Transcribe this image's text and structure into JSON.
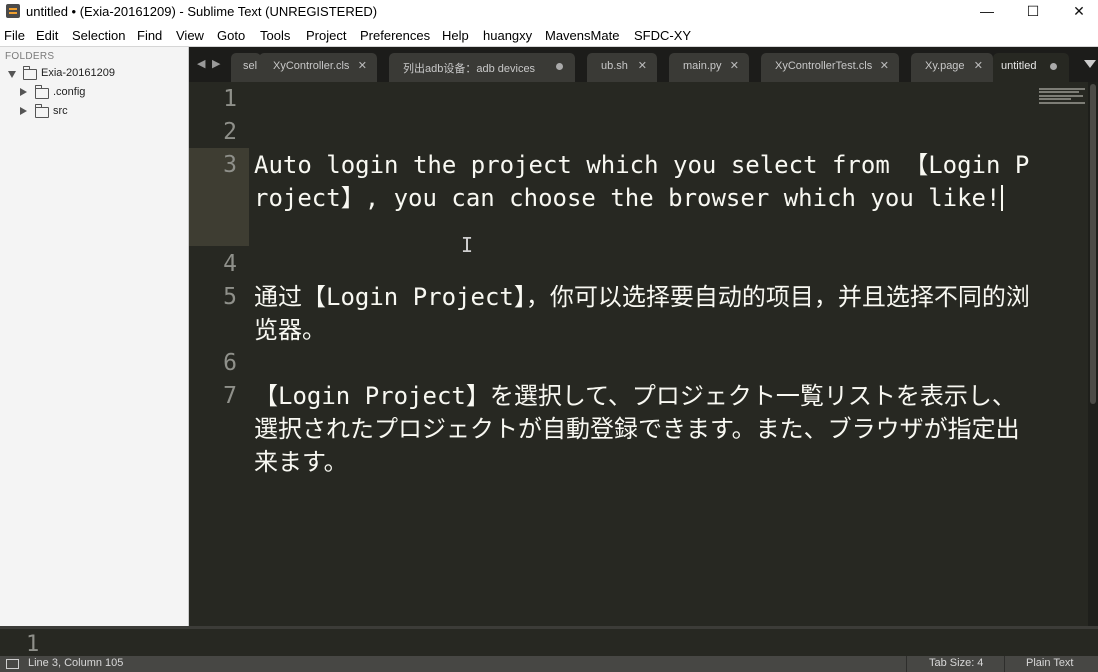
{
  "window": {
    "title": "untitled • (Exia-20161209) - Sublime Text (UNREGISTERED)",
    "minimize": "—",
    "maximize": "☐",
    "close": "✕"
  },
  "menu": [
    "File",
    "Edit",
    "Selection",
    "Find",
    "View",
    "Goto",
    "Tools",
    "Project",
    "Preferences",
    "Help",
    "huangxy",
    "MavensMate",
    "SFDC-XY"
  ],
  "sidebar": {
    "header": "FOLDERS",
    "root": "Exia-20161209",
    "children": [
      ".config",
      "src"
    ]
  },
  "tabs": {
    "nav_left": "◀",
    "nav_right": "▶",
    "items": [
      {
        "label": "sel",
        "close": "✕"
      },
      {
        "label": "XyController.cls",
        "close": "✕"
      },
      {
        "label": "列出adb设备：adb devices",
        "close": "●"
      },
      {
        "label": "ub.sh",
        "close": "✕"
      },
      {
        "label": "main.py",
        "close": "✕"
      },
      {
        "label": "XyControllerTest.cls",
        "close": "✕"
      },
      {
        "label": "Xy.page",
        "close": "✕"
      },
      {
        "label": "untitled",
        "close": "●"
      }
    ]
  },
  "editor": {
    "line_numbers": [
      "1",
      "2",
      "3",
      "4",
      "5",
      "6",
      "7"
    ],
    "lines": [
      "",
      "",
      "Auto login the project which you select from 【Login Project】, you can choose the browser which you like!",
      "",
      "通过【Login Project】，你可以选择要自动的项目，并且选择不同的浏览器。",
      "",
      "【Login Project】を選択して、プロジェクト一覧リストを表示し、選択されたプロジェクトが自動登録できます。また、ブラウザが指定出来ます。"
    ]
  },
  "console": {
    "line_number": "1"
  },
  "status": {
    "position": "Line 3, Column 105",
    "tab_size": "Tab Size: 4",
    "syntax": "Plain Text"
  }
}
